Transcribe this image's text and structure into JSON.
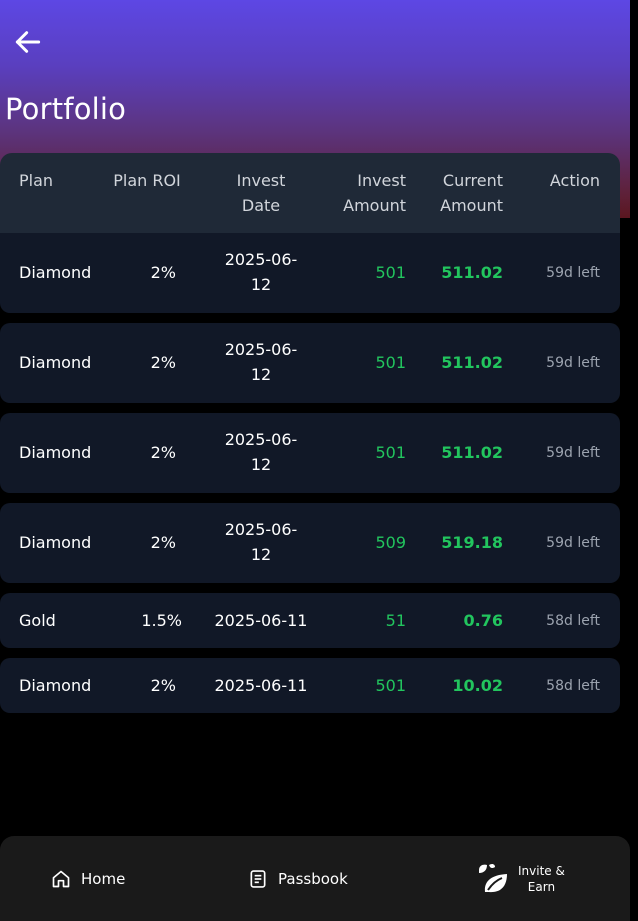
{
  "page": {
    "title": "Portfolio"
  },
  "header": {
    "back_icon": "arrow-left-icon"
  },
  "table": {
    "columns": [
      {
        "line1": "Plan",
        "line2": ""
      },
      {
        "line1": "Plan ROI",
        "line2": ""
      },
      {
        "line1": "Invest",
        "line2": "Date"
      },
      {
        "line1": "Invest",
        "line2": "Amount"
      },
      {
        "line1": "Current",
        "line2": "Amount"
      },
      {
        "line1": "Action",
        "line2": ""
      }
    ],
    "rows": [
      {
        "plan": "Diamond",
        "roi": "2%",
        "date1": "2025-06-",
        "date2": "12",
        "invest": "501",
        "current": "511.02",
        "action": "59d left"
      },
      {
        "plan": "Diamond",
        "roi": "2%",
        "date1": "2025-06-",
        "date2": "12",
        "invest": "501",
        "current": "511.02",
        "action": "59d left"
      },
      {
        "plan": "Diamond",
        "roi": "2%",
        "date1": "2025-06-",
        "date2": "12",
        "invest": "501",
        "current": "511.02",
        "action": "59d left"
      },
      {
        "plan": "Diamond",
        "roi": "2%",
        "date1": "2025-06-",
        "date2": "12",
        "invest": "509",
        "current": "519.18",
        "action": "59d left"
      },
      {
        "plan": "Gold",
        "roi": "1.5%",
        "date1": "2025-06-11",
        "date2": "",
        "invest": "51",
        "current": "0.76",
        "action": "58d left"
      },
      {
        "plan": "Diamond",
        "roi": "2%",
        "date1": "2025-06-11",
        "date2": "",
        "invest": "501",
        "current": "10.02",
        "action": "58d left"
      }
    ]
  },
  "nav": {
    "home": {
      "label": "Home",
      "icon": "home-icon"
    },
    "passbook": {
      "label": "Passbook",
      "icon": "passbook-icon"
    },
    "invite": {
      "label_line1": "Invite &",
      "label_line2": "Earn",
      "icon": "leaf-icon"
    }
  },
  "colors": {
    "accent_green": "#22c55e",
    "row_bg": "#111827",
    "header_bg": "#1f2937",
    "gradient_top": "#5d47e4",
    "gradient_bottom": "#5a1620"
  }
}
